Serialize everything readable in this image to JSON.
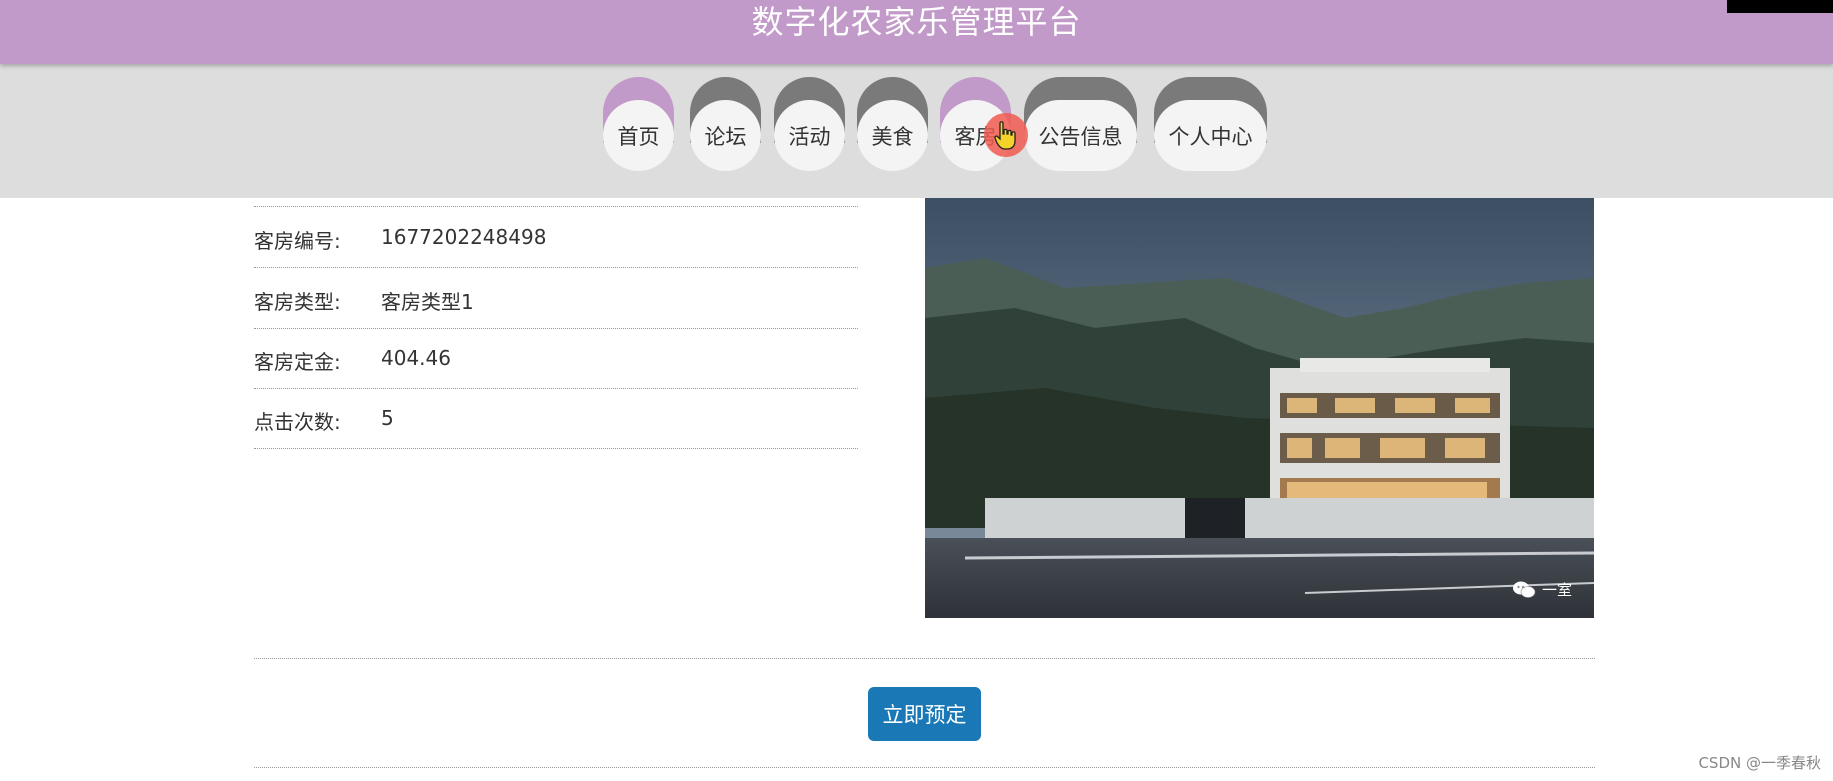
{
  "header": {
    "title": "数字化农家乐管理平台"
  },
  "nav": {
    "items": [
      {
        "label": "首页",
        "active": true
      },
      {
        "label": "论坛",
        "active": false
      },
      {
        "label": "活动",
        "active": false
      },
      {
        "label": "美食",
        "active": false
      },
      {
        "label": "客房",
        "active": true
      },
      {
        "label": "公告信息",
        "active": false
      },
      {
        "label": "个人中心",
        "active": false
      }
    ]
  },
  "details": [
    {
      "label": "客房编号:",
      "value": "1677202248498"
    },
    {
      "label": "客房类型:",
      "value": "客房类型1"
    },
    {
      "label": "客房定金:",
      "value": "404.46"
    },
    {
      "label": "点击次数:",
      "value": "5"
    }
  ],
  "image": {
    "watermark": "一室"
  },
  "actions": {
    "book_label": "立即预定"
  },
  "footer": {
    "watermark": "CSDN @一季春秋"
  },
  "colors": {
    "header": "#c29ac9",
    "nav_bg": "#dddddd",
    "button": "#1a78b6"
  }
}
